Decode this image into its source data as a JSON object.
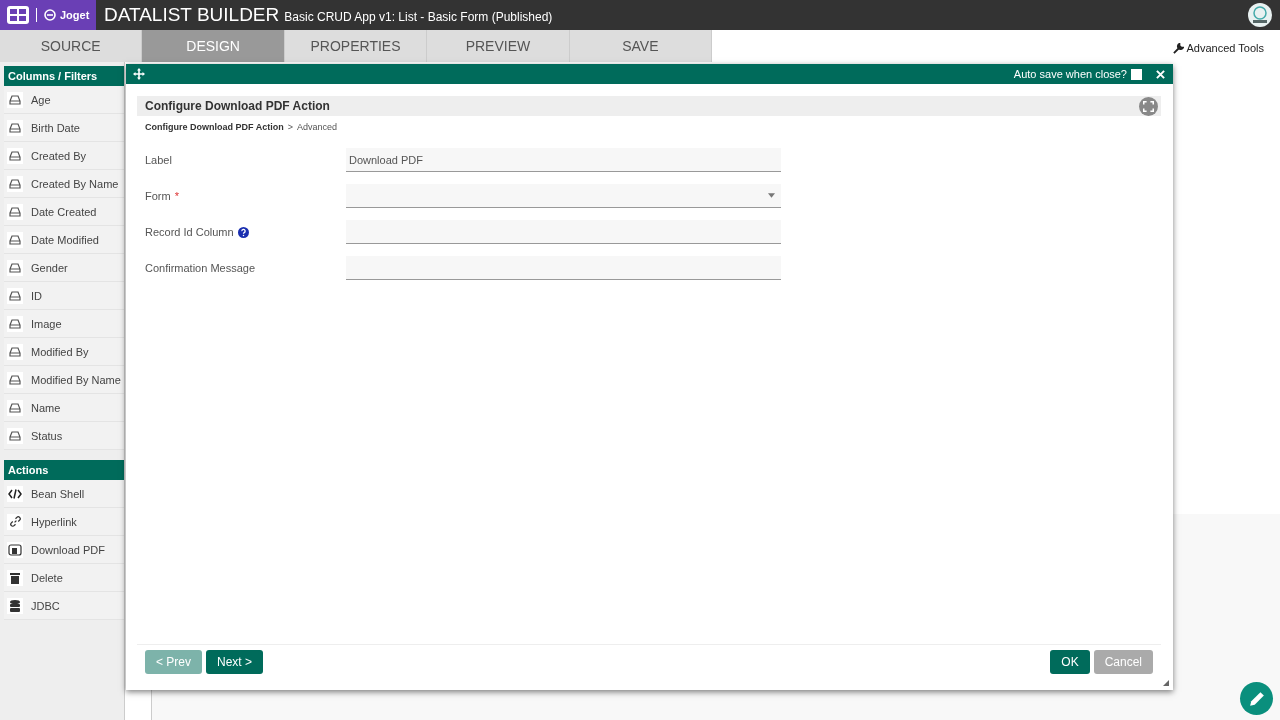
{
  "header": {
    "logo": "Joget",
    "title": "DATALIST BUILDER",
    "subtitle": "Basic CRUD App v1: List - Basic Form (Published)"
  },
  "tabs": [
    {
      "label": "SOURCE",
      "selected": false
    },
    {
      "label": "DESIGN",
      "selected": true
    },
    {
      "label": "PROPERTIES",
      "selected": false
    },
    {
      "label": "PREVIEW",
      "selected": false
    },
    {
      "label": "SAVE",
      "selected": false
    }
  ],
  "advanced_tools": "Advanced Tools",
  "sidebar": [
    {
      "title": "Columns / Filters",
      "items": [
        {
          "label": "Age",
          "kind": "field"
        },
        {
          "label": "Birth Date",
          "kind": "field"
        },
        {
          "label": "Created By",
          "kind": "field"
        },
        {
          "label": "Created By Name",
          "kind": "field"
        },
        {
          "label": "Date Created",
          "kind": "field"
        },
        {
          "label": "Date Modified",
          "kind": "field"
        },
        {
          "label": "Gender",
          "kind": "field"
        },
        {
          "label": "ID",
          "kind": "field"
        },
        {
          "label": "Image",
          "kind": "field"
        },
        {
          "label": "Modified By",
          "kind": "field"
        },
        {
          "label": "Modified By Name",
          "kind": "field"
        },
        {
          "label": "Name",
          "kind": "field"
        },
        {
          "label": "Status",
          "kind": "field"
        }
      ]
    },
    {
      "title": "Actions",
      "items": [
        {
          "label": "Bean Shell",
          "kind": "code"
        },
        {
          "label": "Hyperlink",
          "kind": "link"
        },
        {
          "label": "Download PDF",
          "kind": "pdf"
        },
        {
          "label": "Delete",
          "kind": "trash"
        },
        {
          "label": "JDBC",
          "kind": "database"
        }
      ]
    }
  ],
  "dialog": {
    "auto_save_label": "Auto save when close?",
    "auto_save_checked": false,
    "heading": "Configure Download PDF Action",
    "breadcrumb": [
      {
        "label": "Configure Download PDF Action",
        "selected": true
      },
      {
        "label": "Advanced",
        "selected": false
      }
    ],
    "fields": [
      {
        "label": "Label",
        "kind": "text",
        "value": "Download PDF",
        "required": false,
        "help": false
      },
      {
        "label": "Form",
        "kind": "select",
        "required": true,
        "help": false
      },
      {
        "label": "Record Id Column",
        "kind": "text",
        "required": false,
        "help": true
      },
      {
        "label": "Confirmation Message",
        "kind": "text",
        "required": false,
        "help": false
      }
    ],
    "required_mark": "*",
    "breadcrumb_separator": ">",
    "prev": {
      "label": "< Prev",
      "disabled": true
    },
    "next": {
      "label": "Next >",
      "disabled": false
    },
    "ok": "OK",
    "cancel": "Cancel"
  }
}
